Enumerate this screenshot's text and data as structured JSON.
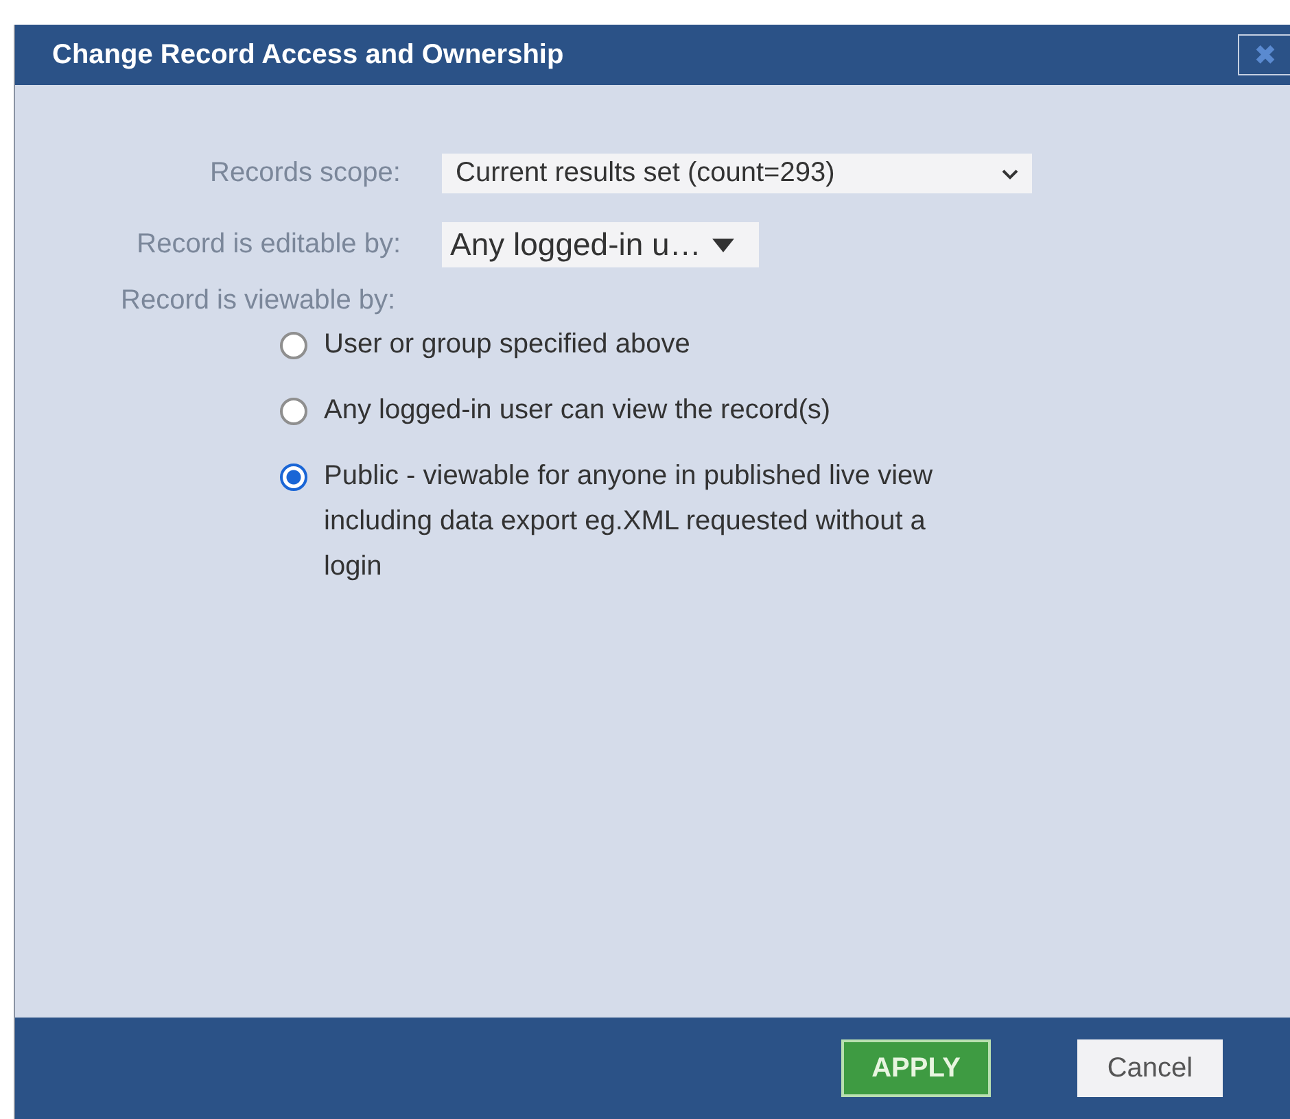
{
  "dialog": {
    "title": "Change Record Access and Ownership",
    "close_label": "✖"
  },
  "fields": [
    {
      "label": "Records scope:",
      "value": "Current results set (count=293)",
      "kind": "chevron"
    },
    {
      "label": "Record is editable by:",
      "value": "Any logged-in u…",
      "kind": "triangle"
    }
  ],
  "viewable": {
    "label": "Record is viewable by:",
    "options": [
      {
        "label": "User or group specified above",
        "selected": false
      },
      {
        "label": "Any logged-in user can view the record(s)",
        "selected": false
      },
      {
        "label": "Public - viewable for anyone in published live view including data export eg.XML requested without a login",
        "selected": true
      }
    ]
  },
  "buttons": [
    {
      "label": "APPLY",
      "kind": "primary"
    },
    {
      "label": "Cancel",
      "kind": "secondary"
    }
  ]
}
